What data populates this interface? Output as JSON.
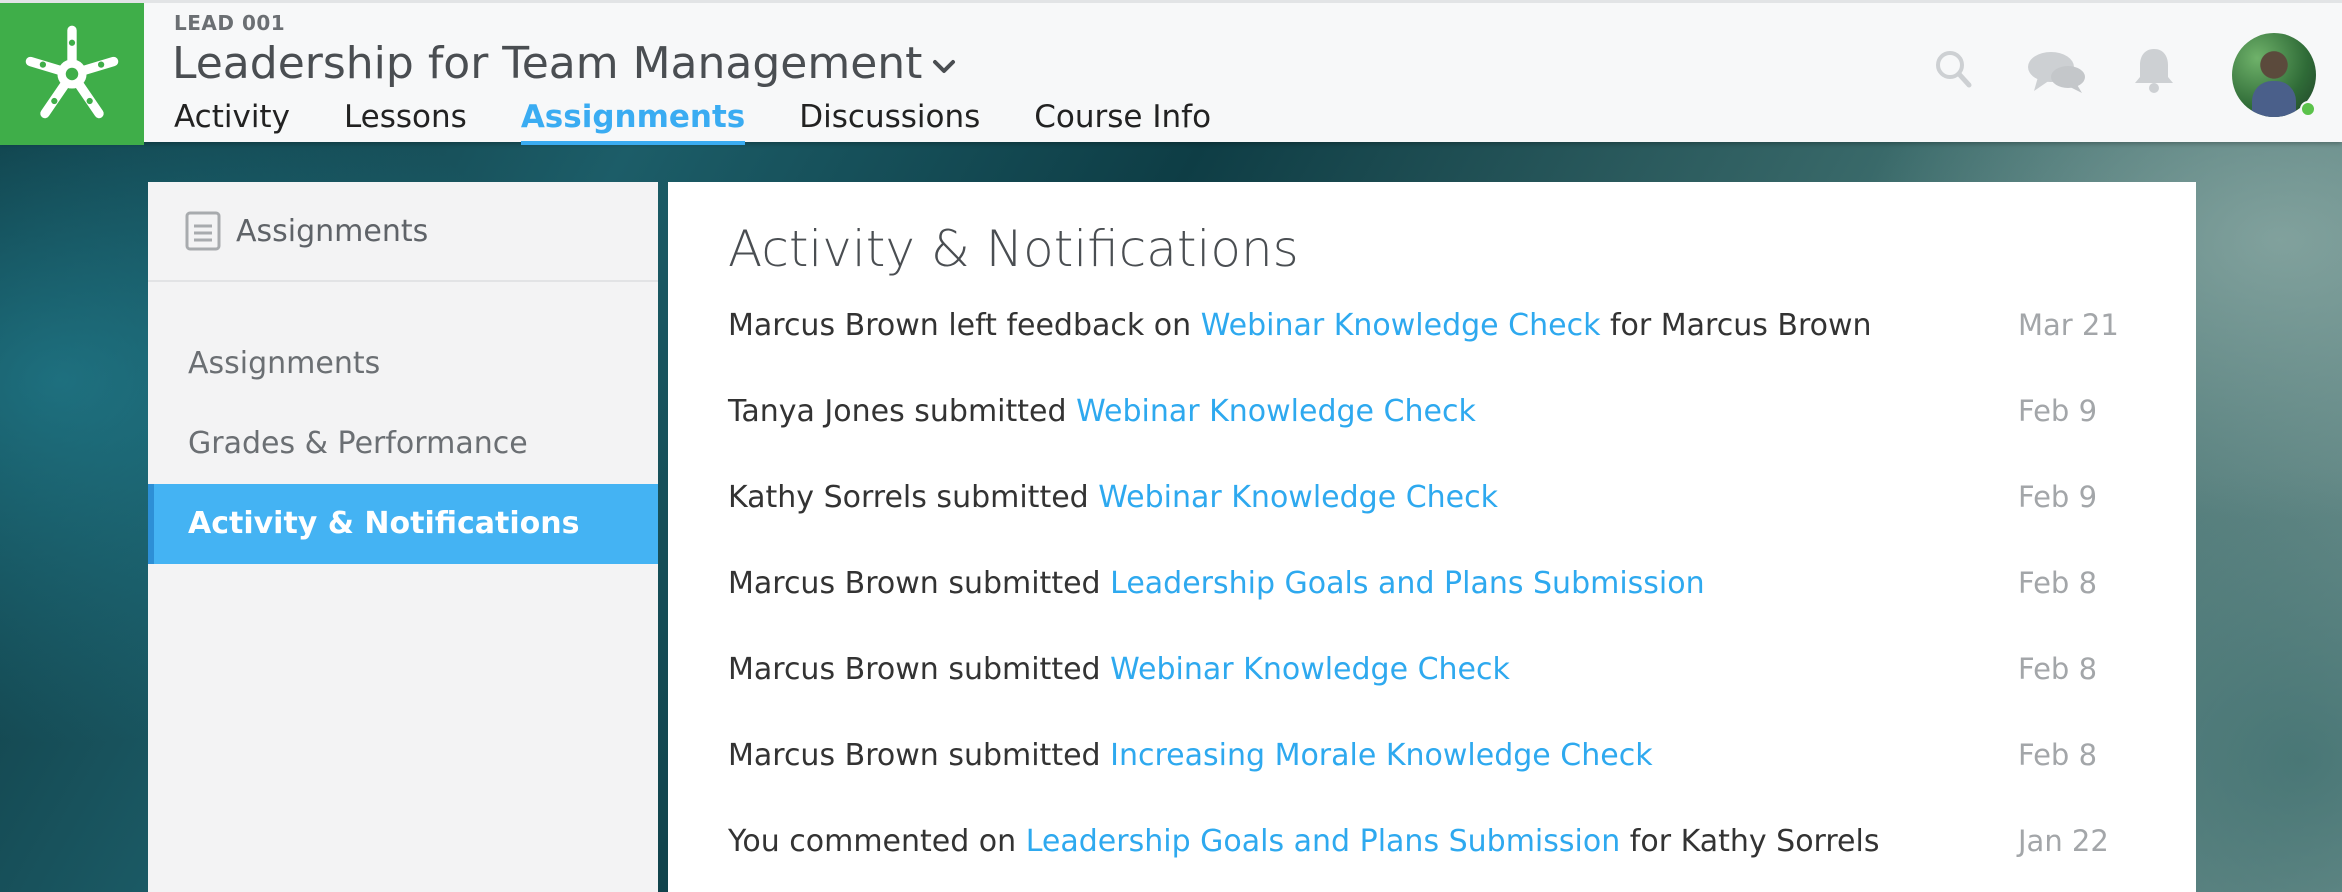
{
  "header": {
    "course_code": "LEAD 001",
    "course_title": "Leadership for Team Management",
    "tabs": [
      {
        "label": "Activity",
        "active": false
      },
      {
        "label": "Lessons",
        "active": false
      },
      {
        "label": "Assignments",
        "active": true
      },
      {
        "label": "Discussions",
        "active": false
      },
      {
        "label": "Course Info",
        "active": false
      }
    ],
    "icons": [
      "logo-icon",
      "chevron-down-icon",
      "search-icon",
      "chat-icon",
      "bell-icon",
      "avatar"
    ],
    "colors": {
      "brand_green": "#3fae49",
      "accent_blue": "#3aacf2"
    }
  },
  "sidebar": {
    "heading": "Assignments",
    "items": [
      {
        "label": "Assignments",
        "active": false
      },
      {
        "label": "Grades & Performance",
        "active": false
      },
      {
        "label": "Activity & Notifications",
        "active": true
      }
    ]
  },
  "main": {
    "title": "Activity & Notifications",
    "feed": [
      {
        "before": "Marcus Brown left feedback on",
        "link": "Webinar Knowledge Check",
        "after": "for Marcus Brown",
        "date": "Mar 21"
      },
      {
        "before": "Tanya Jones submitted",
        "link": "Webinar Knowledge Check",
        "after": "",
        "date": "Feb 9"
      },
      {
        "before": "Kathy Sorrels submitted",
        "link": "Webinar Knowledge Check",
        "after": "",
        "date": "Feb 9"
      },
      {
        "before": "Marcus Brown submitted",
        "link": "Leadership Goals and Plans Submission",
        "after": "",
        "date": "Feb 8"
      },
      {
        "before": "Marcus Brown submitted",
        "link": "Webinar Knowledge Check",
        "after": "",
        "date": "Feb 8"
      },
      {
        "before": "Marcus Brown submitted",
        "link": "Increasing Morale Knowledge Check",
        "after": "",
        "date": "Feb 8"
      },
      {
        "before": "You commented on",
        "link": "Leadership Goals and Plans Submission",
        "after": "for Kathy Sorrels",
        "date": "Jan 22"
      }
    ]
  }
}
